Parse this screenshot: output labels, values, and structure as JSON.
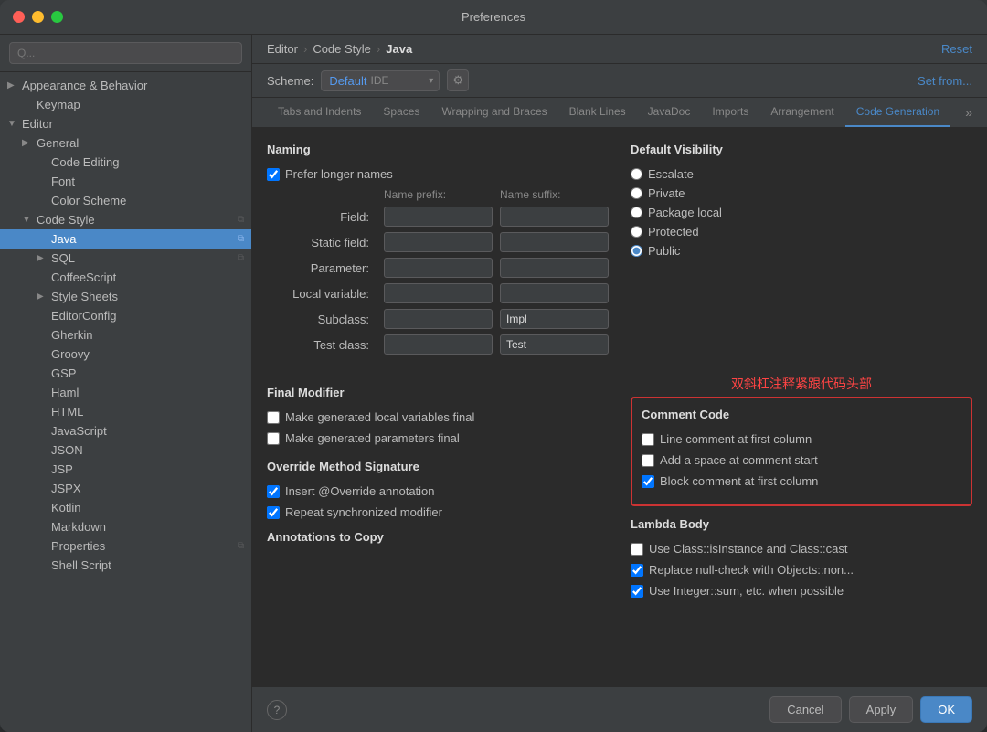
{
  "window": {
    "title": "Preferences"
  },
  "sidebar": {
    "search_placeholder": "Q...",
    "items": [
      {
        "id": "appearance",
        "label": "Appearance & Behavior",
        "indent": 0,
        "arrow": "▶",
        "selected": false,
        "copy": false
      },
      {
        "id": "keymap",
        "label": "Keymap",
        "indent": 1,
        "arrow": "",
        "selected": false,
        "copy": false
      },
      {
        "id": "editor",
        "label": "Editor",
        "indent": 0,
        "arrow": "▼",
        "selected": false,
        "copy": false
      },
      {
        "id": "general",
        "label": "General",
        "indent": 1,
        "arrow": "▶",
        "selected": false,
        "copy": false
      },
      {
        "id": "code-editing",
        "label": "Code Editing",
        "indent": 2,
        "arrow": "",
        "selected": false,
        "copy": false
      },
      {
        "id": "font",
        "label": "Font",
        "indent": 2,
        "arrow": "",
        "selected": false,
        "copy": false
      },
      {
        "id": "color-scheme",
        "label": "Color Scheme",
        "indent": 2,
        "arrow": "",
        "selected": false,
        "copy": false
      },
      {
        "id": "code-style",
        "label": "Code Style",
        "indent": 1,
        "arrow": "▼",
        "selected": false,
        "copy": true
      },
      {
        "id": "java",
        "label": "Java",
        "indent": 2,
        "arrow": "",
        "selected": true,
        "copy": true
      },
      {
        "id": "sql",
        "label": "SQL",
        "indent": 2,
        "arrow": "▶",
        "selected": false,
        "copy": true
      },
      {
        "id": "coffeescript",
        "label": "CoffeeScript",
        "indent": 2,
        "arrow": "",
        "selected": false,
        "copy": false
      },
      {
        "id": "style-sheets",
        "label": "Style Sheets",
        "indent": 2,
        "arrow": "▶",
        "selected": false,
        "copy": false
      },
      {
        "id": "editorconfig",
        "label": "EditorConfig",
        "indent": 2,
        "arrow": "",
        "selected": false,
        "copy": false
      },
      {
        "id": "gherkin",
        "label": "Gherkin",
        "indent": 2,
        "arrow": "",
        "selected": false,
        "copy": false
      },
      {
        "id": "groovy",
        "label": "Groovy",
        "indent": 2,
        "arrow": "",
        "selected": false,
        "copy": false
      },
      {
        "id": "gsp",
        "label": "GSP",
        "indent": 2,
        "arrow": "",
        "selected": false,
        "copy": false
      },
      {
        "id": "haml",
        "label": "Haml",
        "indent": 2,
        "arrow": "",
        "selected": false,
        "copy": false
      },
      {
        "id": "html",
        "label": "HTML",
        "indent": 2,
        "arrow": "",
        "selected": false,
        "copy": false
      },
      {
        "id": "javascript",
        "label": "JavaScript",
        "indent": 2,
        "arrow": "",
        "selected": false,
        "copy": false
      },
      {
        "id": "json",
        "label": "JSON",
        "indent": 2,
        "arrow": "",
        "selected": false,
        "copy": false
      },
      {
        "id": "jsp",
        "label": "JSP",
        "indent": 2,
        "arrow": "",
        "selected": false,
        "copy": false
      },
      {
        "id": "jspx",
        "label": "JSPX",
        "indent": 2,
        "arrow": "",
        "selected": false,
        "copy": false
      },
      {
        "id": "kotlin",
        "label": "Kotlin",
        "indent": 2,
        "arrow": "",
        "selected": false,
        "copy": false
      },
      {
        "id": "markdown",
        "label": "Markdown",
        "indent": 2,
        "arrow": "",
        "selected": false,
        "copy": false
      },
      {
        "id": "properties",
        "label": "Properties",
        "indent": 2,
        "arrow": "",
        "selected": false,
        "copy": true
      },
      {
        "id": "shell-script",
        "label": "Shell Script",
        "indent": 2,
        "arrow": "",
        "selected": false,
        "copy": false
      }
    ]
  },
  "header": {
    "breadcrumb": {
      "parts": [
        "Editor",
        "Code Style",
        "Java"
      ]
    },
    "reset_label": "Reset"
  },
  "scheme": {
    "label": "Scheme:",
    "value": "Default",
    "ide_text": "IDE",
    "gear_icon": "⚙",
    "set_from_label": "Set from..."
  },
  "tabs": [
    {
      "id": "tabs-indents",
      "label": "Tabs and Indents",
      "active": false
    },
    {
      "id": "spaces",
      "label": "Spaces",
      "active": false
    },
    {
      "id": "wrapping-braces",
      "label": "Wrapping and Braces",
      "active": false
    },
    {
      "id": "blank-lines",
      "label": "Blank Lines",
      "active": false
    },
    {
      "id": "javadoc",
      "label": "JavaDoc",
      "active": false
    },
    {
      "id": "imports",
      "label": "Imports",
      "active": false
    },
    {
      "id": "arrangement",
      "label": "Arrangement",
      "active": false
    },
    {
      "id": "code-generation",
      "label": "Code Generation",
      "active": true
    }
  ],
  "naming": {
    "title": "Naming",
    "prefer_longer_names": {
      "label": "Prefer longer names",
      "checked": true
    },
    "name_prefix_label": "Name prefix:",
    "name_suffix_label": "Name suffix:",
    "fields": [
      {
        "label": "Field:",
        "prefix_value": "",
        "suffix_value": ""
      },
      {
        "label": "Static field:",
        "prefix_value": "",
        "suffix_value": ""
      },
      {
        "label": "Parameter:",
        "prefix_value": "",
        "suffix_value": ""
      },
      {
        "label": "Local variable:",
        "prefix_value": "",
        "suffix_value": ""
      },
      {
        "label": "Subclass:",
        "prefix_value": "",
        "suffix_value": "Impl"
      },
      {
        "label": "Test class:",
        "prefix_value": "",
        "suffix_value": "Test"
      }
    ]
  },
  "default_visibility": {
    "title": "Default Visibility",
    "options": [
      {
        "label": "Escalate",
        "value": "escalate",
        "selected": false
      },
      {
        "label": "Private",
        "value": "private",
        "selected": false
      },
      {
        "label": "Package local",
        "value": "package-local",
        "selected": false
      },
      {
        "label": "Protected",
        "value": "protected",
        "selected": false
      },
      {
        "label": "Public",
        "value": "public",
        "selected": true
      }
    ]
  },
  "final_modifier": {
    "title": "Final Modifier",
    "options": [
      {
        "label": "Make generated local variables final",
        "checked": false
      },
      {
        "label": "Make generated parameters final",
        "checked": false
      }
    ]
  },
  "comment_code": {
    "title": "Comment Code",
    "annotation": "双斜杠注释紧跟代码头部",
    "options": [
      {
        "label": "Line comment at first column",
        "checked": false
      },
      {
        "label": "Add a space at comment start",
        "checked": false
      },
      {
        "label": "Block comment at first column",
        "checked": true
      }
    ]
  },
  "override_method": {
    "title": "Override Method Signature",
    "options": [
      {
        "label": "Insert @Override annotation",
        "checked": true
      },
      {
        "label": "Repeat synchronized modifier",
        "checked": true
      }
    ]
  },
  "lambda_body": {
    "title": "Lambda Body",
    "options": [
      {
        "label": "Use Class::isInstance and Class::cast",
        "checked": false
      },
      {
        "label": "Replace null-check with Objects::non...",
        "checked": true
      },
      {
        "label": "Use Integer::sum, etc. when possible",
        "checked": true
      }
    ]
  },
  "annotations_to_copy": {
    "title": "Annotations to Copy"
  },
  "footer": {
    "help_label": "?",
    "cancel_label": "Cancel",
    "apply_label": "Apply",
    "ok_label": "OK"
  }
}
